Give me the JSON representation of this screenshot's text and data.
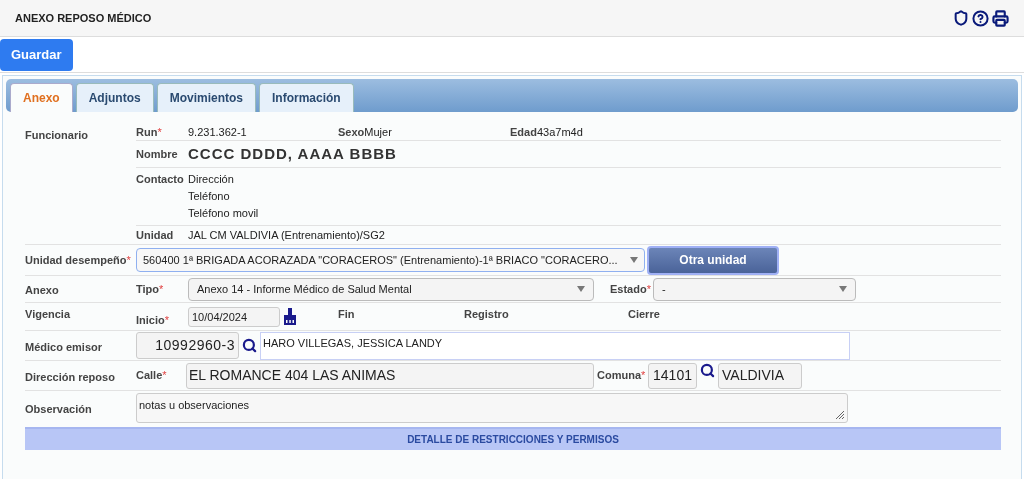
{
  "header": {
    "title": "ANEXO REPOSO MÉDICO"
  },
  "toolbar": {
    "buttons": [
      "Guardar"
    ]
  },
  "tabs": [
    {
      "label": "Anexo",
      "selected": true
    },
    {
      "label": "Adjuntos",
      "selected": false
    },
    {
      "label": "Movimientos",
      "selected": false
    },
    {
      "label": "Información",
      "selected": false
    }
  ],
  "funcionario": {
    "label": "Funcionario",
    "run": {
      "label": "Run",
      "mark": "*",
      "value": "9.231.362-1"
    },
    "sexo": {
      "label": "Sexo",
      "value": "Mujer"
    },
    "edad": {
      "label": "Edad",
      "value": "43a7m4d"
    },
    "nombre": {
      "label": "Nombre",
      "value": "CCCC DDDD, AAAA BBBB"
    },
    "contacto": {
      "label": "Contacto",
      "lines": [
        "Dirección",
        "Teléfono",
        "Teléfono movil"
      ]
    },
    "unidad": {
      "label": "Unidad",
      "value": "JAL CM VALDIVIA (Entrenamiento)/SG2"
    }
  },
  "unidad_desempeno": {
    "label": "Unidad desempeño",
    "mark": "*",
    "value": "560400 1ª BRIGADA ACORAZADA \"CORACEROS\" (Entrenamiento)-1ª BRIACO \"CORACERO...",
    "button": "Otra unidad"
  },
  "anexo": {
    "label": "Anexo",
    "tipo": {
      "label": "Tipo",
      "mark": "*",
      "value": "Anexo 14 - Informe Médico de Salud Mental"
    },
    "estado": {
      "label": "Estado",
      "mark": "*",
      "value": "-"
    }
  },
  "vigencia": {
    "label": "Vigencia",
    "inicio": {
      "label": "Inicio",
      "mark": "*",
      "value": "10/04/2024"
    },
    "others": [
      "Fin",
      "Registro",
      "Cierre"
    ]
  },
  "medico": {
    "label": "Médico emisor",
    "rut": "10992960-3",
    "name": "HARO VILLEGAS, JESSICA LANDY"
  },
  "direccion": {
    "label": "Dirección reposo",
    "calle": {
      "label": "Calle",
      "mark": "*",
      "value": "EL ROMANCE 404 LAS ANIMAS"
    },
    "comuna": {
      "label": "Comuna",
      "mark": "*",
      "code": "14101",
      "name": "VALDIVIA"
    }
  },
  "observacion": {
    "label": "Observación",
    "value": "notas u observaciones"
  },
  "section_bar": {
    "title": "DETALLE DE RESTRICCIONES Y PERMISOS"
  }
}
